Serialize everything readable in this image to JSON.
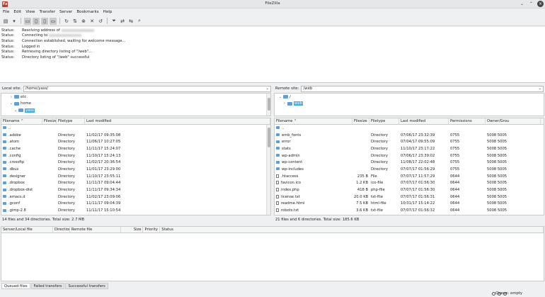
{
  "window": {
    "title": "FileZilla",
    "app_icon_letter": "Fz"
  },
  "menu": [
    "File",
    "Edit",
    "View",
    "Transfer",
    "Server",
    "Bookmarks",
    "Help"
  ],
  "toolbar_icons": [
    "site-manager-icon",
    "site-dropdown-icon",
    "toggle-log-icon",
    "toggle-local-tree-icon",
    "toggle-remote-tree-icon",
    "toggle-queue-icon",
    "refresh-icon",
    "process-queue-icon",
    "cancel-icon",
    "disconnect-icon",
    "reconnect-icon",
    "filter-icon",
    "compare-icon",
    "sync-browse-icon",
    "search-icon"
  ],
  "log": [
    {
      "label": "Status:",
      "text": "Resolving address of",
      "redacted": true
    },
    {
      "label": "Status:",
      "text": "Connecting to",
      "redacted": true
    },
    {
      "label": "Status:",
      "text": "Connection established, waiting for welcome message...",
      "redacted": false
    },
    {
      "label": "Status:",
      "text": "Logged in",
      "redacted": false
    },
    {
      "label": "Status:",
      "text": "Retrieving directory listing of \"/web\"...",
      "redacted": false
    },
    {
      "label": "Status:",
      "text": "Directory listing of \"/web\" successful",
      "redacted": false
    }
  ],
  "local": {
    "site_label": "Local site:",
    "path": "/home/yass/",
    "tree": [
      {
        "name": "etc",
        "expander": "›",
        "level": 1,
        "selected": false
      },
      {
        "name": "home",
        "expander": "⌄",
        "level": 1,
        "selected": false
      },
      {
        "name": "yass",
        "expander": "⌄",
        "level": 2,
        "selected": true
      }
    ],
    "columns": [
      "Filename",
      "Filesize",
      "Filetype",
      "Last modified"
    ],
    "files": [
      {
        "name": "..",
        "size": "",
        "type": "",
        "modified": "",
        "folder": true
      },
      {
        "name": ".adobe",
        "size": "",
        "type": "Directory",
        "modified": "11/02/17 09:35:08",
        "folder": true
      },
      {
        "name": ".atom",
        "size": "",
        "type": "Directory",
        "modified": "11/06/17 10:27:05",
        "folder": true
      },
      {
        "name": ".cache",
        "size": "",
        "type": "Directory",
        "modified": "11/11/17 15:24:07",
        "folder": true
      },
      {
        "name": ".config",
        "size": "",
        "type": "Directory",
        "modified": "11/10/17 15:24:13",
        "folder": true
      },
      {
        "name": ".crossftp",
        "size": "",
        "type": "Directory",
        "modified": "11/02/17 20:36:54",
        "folder": true
      },
      {
        "name": ".dbus",
        "size": "",
        "type": "Directory",
        "modified": "11/01/17 23:29:00",
        "folder": true
      },
      {
        "name": ".designer",
        "size": "",
        "type": "Directory",
        "modified": "11/10/17 23:55:11",
        "folder": true
      },
      {
        "name": ".dropbox",
        "size": "",
        "type": "Directory",
        "modified": "11/11/17 09:04:44",
        "folder": true
      },
      {
        "name": ".dropbox-dist",
        "size": "",
        "type": "Directory",
        "modified": "11/11/17 09:34:34",
        "folder": true
      },
      {
        "name": ".emacs.d",
        "size": "",
        "type": "Directory",
        "modified": "11/02/17 23:09:06",
        "folder": true
      },
      {
        "name": ".gconf",
        "size": "",
        "type": "Directory",
        "modified": "11/11/17 09:04:39",
        "folder": true
      },
      {
        "name": ".gimp-2.8",
        "size": "",
        "type": "Directory",
        "modified": "11/11/17 15:10:54",
        "folder": true
      }
    ],
    "status": "14 files and 34 directories. Total size: 2.7 MB"
  },
  "remote": {
    "site_label": "Remote site:",
    "path": "/web",
    "tree": [
      {
        "name": "/",
        "expander": "⌄",
        "level": 0,
        "selected": false
      },
      {
        "name": "web",
        "expander": "›",
        "level": 1,
        "selected": true
      }
    ],
    "columns": [
      "Filename",
      "Filesize",
      "Filetype",
      "Last modified",
      "Permissions",
      "Owner/Grou"
    ],
    "files": [
      {
        "name": "..",
        "size": "",
        "type": "",
        "modified": "",
        "perms": "",
        "owner": "",
        "folder": true
      },
      {
        "name": "emb_fonts",
        "size": "",
        "type": "Directory",
        "modified": "07/06/17 23:32:39",
        "perms": "0755",
        "owner": "5008 5005",
        "folder": true
      },
      {
        "name": "error",
        "size": "",
        "type": "Directory",
        "modified": "07/04/17 09:55:09",
        "perms": "0755",
        "owner": "5008 5005",
        "folder": true
      },
      {
        "name": "stats",
        "size": "",
        "type": "Directory",
        "modified": "11/10/17 23:17:22",
        "perms": "0755",
        "owner": "5008 5005",
        "folder": true
      },
      {
        "name": "wp-admin",
        "size": "",
        "type": "Directory",
        "modified": "07/06/17 23:39:02",
        "perms": "0755",
        "owner": "5008 5005",
        "folder": true
      },
      {
        "name": "wp-content",
        "size": "",
        "type": "Directory",
        "modified": "11/08/17 22:02:48",
        "perms": "0755",
        "owner": "5008 5005",
        "folder": true
      },
      {
        "name": "wp-includes",
        "size": "",
        "type": "Directory",
        "modified": "07/07/17 01:56:29",
        "perms": "0755",
        "owner": "5008 5005",
        "folder": true
      },
      {
        "name": ".htaccess",
        "size": "235 B",
        "type": "File",
        "modified": "07/07/17 11:57:29",
        "perms": "0644",
        "owner": "5008 5005",
        "folder": false
      },
      {
        "name": "favicon.ico",
        "size": "1.2 KB",
        "type": "ico-file",
        "modified": "07/07/17 01:56:30",
        "perms": "0644",
        "owner": "5008 5005",
        "folder": false
      },
      {
        "name": "index.php",
        "size": "418 B",
        "type": "php-file",
        "modified": "07/07/17 01:56:30",
        "perms": "0644",
        "owner": "5008 5005",
        "folder": false
      },
      {
        "name": "license.txt",
        "size": "20.0 KB",
        "type": "txt-file",
        "modified": "07/07/17 01:56:31",
        "perms": "0644",
        "owner": "5008 5005",
        "folder": false
      },
      {
        "name": "readme.html",
        "size": "7.5 KB",
        "type": "html-file",
        "modified": "10/31/17 15:14:22",
        "perms": "0644",
        "owner": "5008 5005",
        "folder": false
      },
      {
        "name": "robots.txt",
        "size": "3.6 KB",
        "type": "txt-file",
        "modified": "07/07/17 01:56:32",
        "perms": "0644",
        "owner": "5008 5005",
        "folder": false
      }
    ],
    "status": "21 files and 6 directories. Total size: 185.6 KB"
  },
  "queue": {
    "columns": [
      "Server/Local file",
      "Direction",
      "Remote file",
      "Size",
      "Priority",
      "Status"
    ],
    "tabs": [
      "Queued files",
      "Failed transfers",
      "Successful transfers"
    ],
    "status": "Queue: empty"
  }
}
